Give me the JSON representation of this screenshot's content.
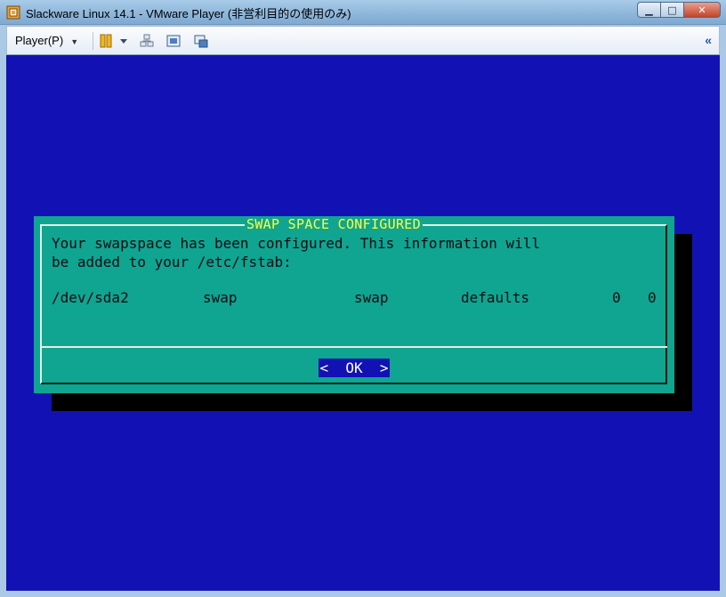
{
  "window": {
    "title": "Slackware Linux 14.1 - VMware Player (非営利目的の使用のみ)",
    "buttons": {
      "minimize": "▁",
      "maximize": "□",
      "close": "✕"
    }
  },
  "toolbar": {
    "player_menu": "Player(P)",
    "icons": [
      "pause-icon",
      "dropdown-caret-icon",
      "devices-icon",
      "fullscreen-icon",
      "unity-icon"
    ],
    "collapse": "«"
  },
  "dialog": {
    "title": "SWAP SPACE CONFIGURED",
    "message_line1": "Your swapspace has been configured. This information will",
    "message_line2": "be added to your /etc/fstab:",
    "fstab_entry": {
      "device": "/dev/sda2",
      "mount": "swap",
      "type": "swap",
      "options": "defaults",
      "dump": "0",
      "pass": "0"
    },
    "ok_button": "<  OK  >"
  },
  "colors": {
    "screen_bg": "#1212b4",
    "dialog_bg": "#0fa590",
    "title_color": "#ffff3a"
  }
}
